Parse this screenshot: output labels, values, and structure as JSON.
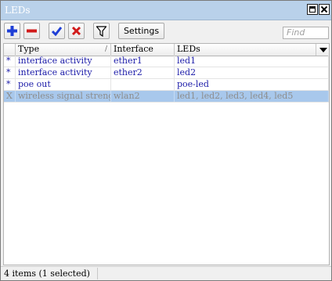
{
  "window": {
    "title": "LEDs"
  },
  "toolbar": {
    "settings_label": "Settings",
    "find_placeholder": "Find"
  },
  "table": {
    "columns": [
      "Type",
      "Interface",
      "LEDs"
    ],
    "rows": [
      {
        "flag": "*",
        "type": "interface activity",
        "interface": "ether1",
        "leds": "led1",
        "disabled": false,
        "selected": false
      },
      {
        "flag": "*",
        "type": "interface activity",
        "interface": "ether2",
        "leds": "led2",
        "disabled": false,
        "selected": false
      },
      {
        "flag": "*",
        "type": "poe out",
        "interface": "",
        "leds": "poe-led",
        "disabled": false,
        "selected": false
      },
      {
        "flag": "X",
        "type": "wireless signal strength",
        "interface": "wlan2",
        "leds": "led1, led2, led3, led4, led5",
        "disabled": true,
        "selected": true
      }
    ]
  },
  "status": {
    "text": "4 items (1 selected)"
  },
  "colors": {
    "titlebar": "#b9d1ea",
    "add_icon": "#1f3fd6",
    "remove_icon": "#d11b1b",
    "enable_icon": "#1f3fd6",
    "disable_icon": "#d11b1b",
    "row_text": "#1a1aa8",
    "disabled_text": "#8d8d8d",
    "selected_row": "#a8c8ec"
  }
}
